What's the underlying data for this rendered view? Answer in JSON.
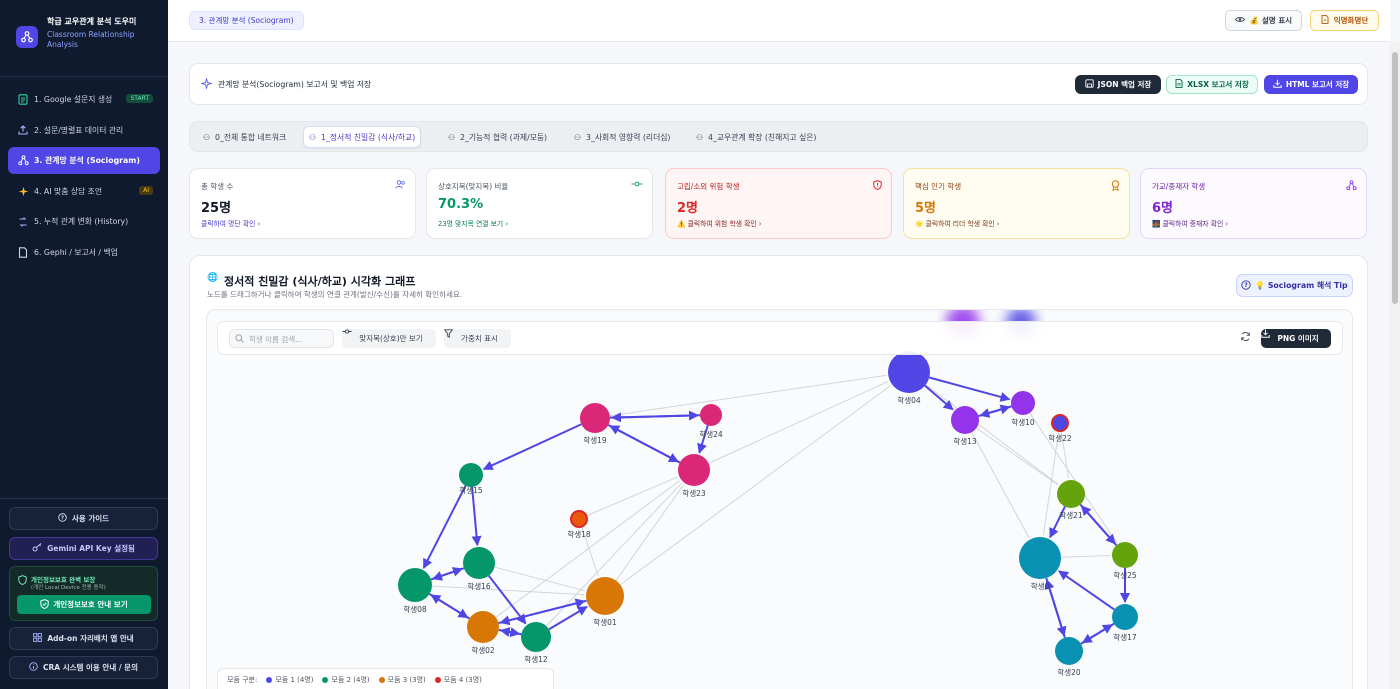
{
  "app": {
    "title": "학급 교우관계 분석 도우미",
    "subtitle": "Classroom Relationship Analysis"
  },
  "sidebar": {
    "items": [
      {
        "label": "1. Google 설문지 생성",
        "badge": "START"
      },
      {
        "label": "2. 설문/명렬표 데이터 관리",
        "badge": ""
      },
      {
        "label": "3. 관계망 분석 (Sociogram)",
        "badge": ""
      },
      {
        "label": "4. AI 맞춤 상담 조언",
        "badge": "AI"
      },
      {
        "label": "5. 누적 관계 변화 (History)",
        "badge": ""
      },
      {
        "label": "6. Gephi / 보고서 / 백업",
        "badge": ""
      }
    ],
    "guide_label": "사용 가이드",
    "gemini_label": "Gemini API Key 설정됨",
    "privacy_title": "개인정보보호 완벽 보장",
    "privacy_sub": "(개인 Local Device 전용 동작)",
    "privacy_btn": "개인정보보호 안내 보기",
    "addon_label": "Add-on 자리배치 앱 안내",
    "cra_label": "CRA 시스템 이용 안내 / 문의"
  },
  "header": {
    "breadcrumb": "3. 관계망 분석 (Sociogram)",
    "explain_label": "💰 설명 표시",
    "anon_label": "익명화명단"
  },
  "report": {
    "title": "관계망 분석(Sociogram) 보고서 및 백업 저장",
    "json_label": "JSON 백업 저장",
    "xlsx_label": "XLSX 보고서 저장",
    "html_label": "HTML 보고서 저장"
  },
  "tabs": [
    "0_전체 통합 네트워크",
    "1_정서적 친밀감 (식사/하교)",
    "2_기능적 협력 (과제/모둠)",
    "3_사회적 영향력 (리더십)",
    "4_교우관계 확장 (친해지고 싶은)"
  ],
  "stats": [
    {
      "title": "총 학생 수",
      "value": "25명",
      "link": "클릭하여 명단 확인 ›"
    },
    {
      "title": "상호지목(맞지목) 비율",
      "value": "70.3%",
      "link": "23명 맞지목 연결 보기 ›"
    },
    {
      "title": "고립/소외 위험 학생",
      "value": "2명",
      "link": "⚠️ 클릭하여 위험 학생 확인 ›"
    },
    {
      "title": "핵심 인기 학생",
      "value": "5명",
      "link": "🌟 클릭하여 리더 학생 확인 ›"
    },
    {
      "title": "가교/중재자 학생",
      "value": "6명",
      "link": "🌉 클릭하여 중재자 확인 ›"
    }
  ],
  "graph": {
    "title": "정서적 친밀감 (식사/하교) 시각화 그래프",
    "subtitle": "노드를 드래그하거나 클릭하여 학생의 연결 관계(발신/수신)를 자세히 확인하세요.",
    "tip_label": "💡 Sociogram 해석 Tip",
    "search_placeholder": "학생 이름 검색...",
    "mutual_label": "맞지목(상호)만 보기",
    "weight_label": "가중치 표시",
    "png_label": "PNG 이미지",
    "legend_title": "모둠 구분:",
    "legend": [
      {
        "label": "모둠 1 (4명)",
        "color": "#4f46e5"
      },
      {
        "label": "모둠 2 (4명)",
        "color": "#059669"
      },
      {
        "label": "모둠 3 (3명)",
        "color": "#d97706"
      },
      {
        "label": "모둠 4 (3명)",
        "color": "#dc2626"
      }
    ],
    "nodes": [
      {
        "id": "학생04",
        "color": "#4f46e5",
        "size": 21
      },
      {
        "id": "학생13",
        "color": "#9333ea",
        "size": 14
      },
      {
        "id": "학생10",
        "color": "#9333ea",
        "size": 12
      },
      {
        "id": "학생22",
        "color": "#4f46e5",
        "size": 8
      },
      {
        "id": "학생19",
        "color": "#db2777",
        "size": 15
      },
      {
        "id": "학생24",
        "color": "#db2777",
        "size": 11
      },
      {
        "id": "학생23",
        "color": "#db2777",
        "size": 16
      },
      {
        "id": "학생15",
        "color": "#059669",
        "size": 12
      },
      {
        "id": "학생18",
        "color": "#ea580c",
        "size": 8
      },
      {
        "id": "학생16",
        "color": "#059669",
        "size": 16
      },
      {
        "id": "학생08",
        "color": "#059669",
        "size": 17
      },
      {
        "id": "학생02",
        "color": "#d97706",
        "size": 16
      },
      {
        "id": "학생12",
        "color": "#059669",
        "size": 15
      },
      {
        "id": "학생01",
        "color": "#d97706",
        "size": 19
      },
      {
        "id": "학생21",
        "color": "#65a30d",
        "size": 14
      },
      {
        "id": "학생25",
        "color": "#65a30d",
        "size": 13
      },
      {
        "id": "학생0",
        "color": "#0891b2",
        "size": 21
      },
      {
        "id": "학생17",
        "color": "#0891b2",
        "size": 13
      },
      {
        "id": "학생20",
        "color": "#0891b2",
        "size": 14
      }
    ]
  }
}
